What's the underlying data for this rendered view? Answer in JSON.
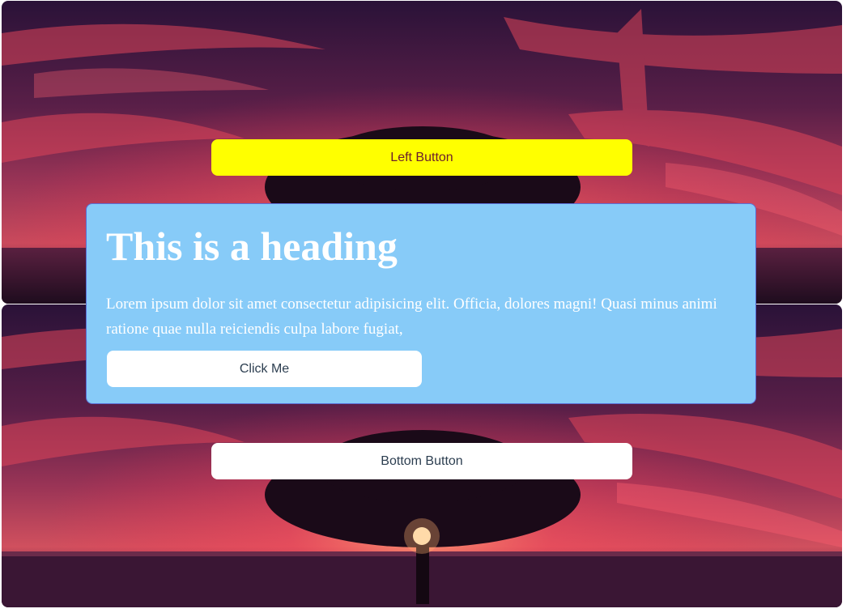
{
  "buttons": {
    "left_label": "Left Button",
    "bottom_label": "Bottom Button",
    "click_label": "Click Me"
  },
  "card": {
    "heading": "This is a heading",
    "body": "Lorem ipsum dolor sit amet consectetur adipisicing elit. Officia, dolores magni! Quasi minus animi ratione quae nulla reiciendis culpa labore fugiat,"
  },
  "colors": {
    "left_button_bg": "#ffff00",
    "card_bg": "#87cbf8",
    "button_bg": "#ffffff"
  }
}
